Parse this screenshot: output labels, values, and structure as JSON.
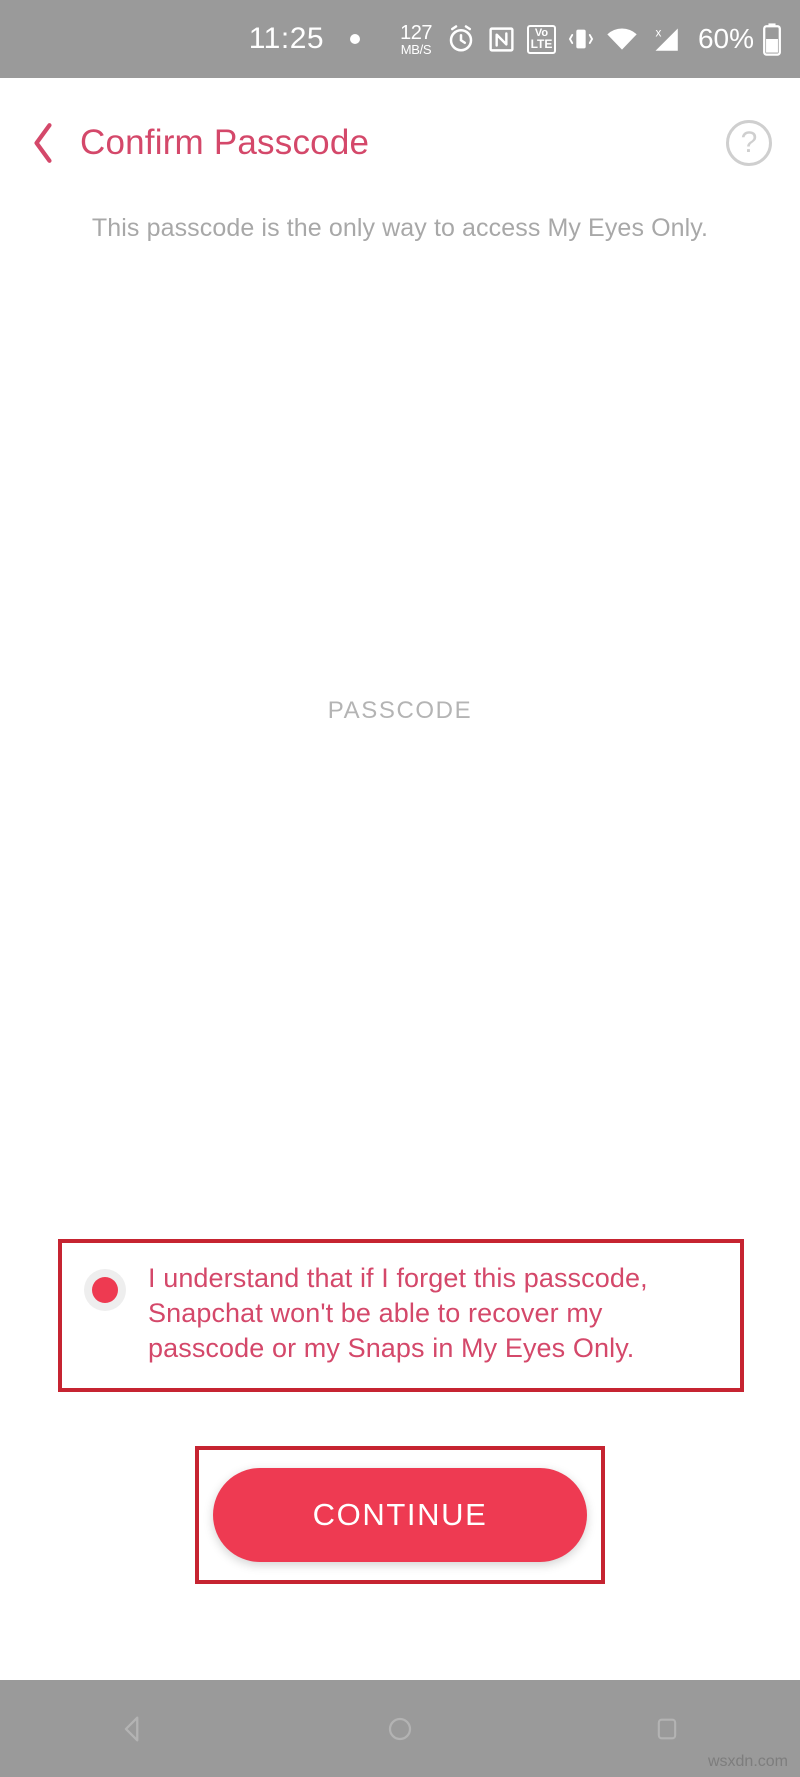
{
  "status_bar": {
    "time": "11:25",
    "data_speed_value": "127",
    "data_speed_unit": "MB/S",
    "battery_percent": "60%",
    "icons": [
      "recording-dot-icon",
      "alarm-clock-icon",
      "nfc-icon",
      "volte-icon",
      "vibrate-icon",
      "wifi-icon",
      "cellular-signal-icon",
      "battery-icon"
    ],
    "volte_top": "Vo",
    "volte_bottom": "LTE",
    "background_color": "#9a9a9a"
  },
  "header": {
    "back_label": "back-chevron",
    "title": "Confirm Passcode",
    "help_label": "?",
    "title_color": "#d4486a"
  },
  "subtitle": "This passcode is the only way to access My Eyes Only.",
  "passcode_field": {
    "label": "PASSCODE",
    "value": ""
  },
  "consent": {
    "checked": true,
    "text": "I understand that if I forget this passcode, Snapchat won't be able to recover my passcode or my Snaps in My Eyes Only.",
    "accent_color": "#ee3a51",
    "text_color": "#d4486a"
  },
  "continue": {
    "label": "CONTINUE",
    "color": "#ee3a52"
  },
  "annotation": {
    "border_color": "#c62431"
  },
  "nav_bar": {
    "back": "nav-back-icon",
    "home": "nav-home-icon",
    "recents": "nav-recents-icon"
  },
  "watermark": "wsxdn.com"
}
